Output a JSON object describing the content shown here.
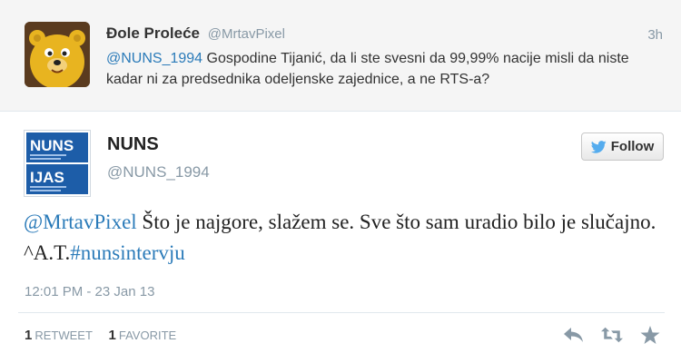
{
  "reply": {
    "name": "Đole Proleće",
    "handle": "@MrtavPixel",
    "time": "3h",
    "mention": "@NUNS_1994",
    "text": " Gospodine Tijanić, da li ste svesni da 99,99% nacije misli da niste kadar ni za predsednika odeljenske zajednice, a ne RTS-a?"
  },
  "tweet": {
    "name": "NUNS",
    "handle": "@NUNS_1994",
    "follow_label": "Follow",
    "mention": "@MrtavPixel",
    "text": " Što je najgore, slažem se. Sve što sam uradio bilo je slučajno. ^A.T.",
    "hashtag": "#nunsintervju",
    "date": "12:01 PM - 23 Jan 13",
    "logo_top": "NUNS",
    "logo_bottom": "IJAS",
    "retweets_count": "1",
    "retweets_label": "RETWEET",
    "favorites_count": "1",
    "favorites_label": "FAVORITE"
  },
  "icons": {
    "follow": "bird-icon",
    "reply": "reply-icon",
    "retweet": "retweet-icon",
    "favorite": "star-icon"
  },
  "colors": {
    "link": "#2b7bb9",
    "muted": "#8899a6",
    "nuns_blue": "#1d5da8"
  }
}
